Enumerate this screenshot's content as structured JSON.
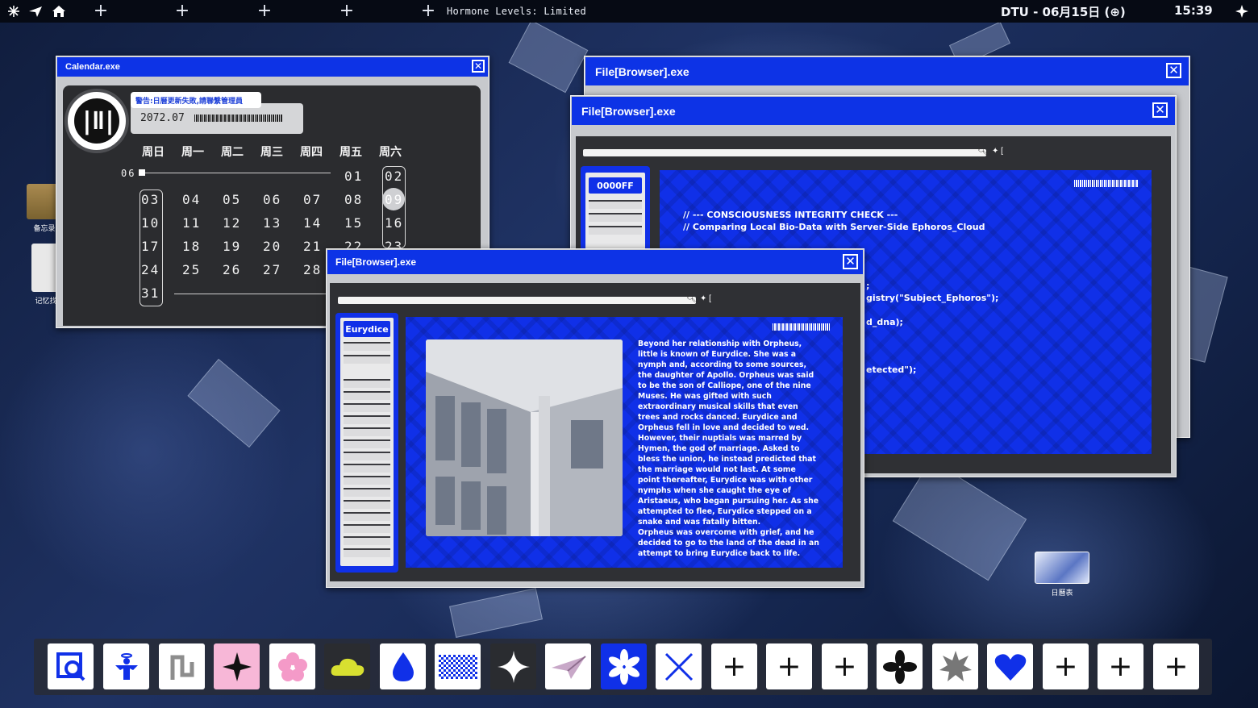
{
  "topbar": {
    "plus_glyph": "+",
    "status_text": "Hormone Levels: Limited",
    "date_text": "DTU - 06月15日 (⊕)",
    "time_text": "15:39",
    "icons": [
      "snowflake-icon",
      "paper-plane-icon",
      "home-icon",
      "sparkle-icon"
    ]
  },
  "calendar": {
    "title": "Calendar.exe",
    "close_glyph": "✕",
    "warning": "警告:日曆更新失敗,請聯繫管理員",
    "year_month": "2072.07",
    "weekdays": [
      "周日",
      "周一",
      "周二",
      "周三",
      "周四",
      "周五",
      "周六"
    ],
    "prev_month": "06",
    "days": {
      "d01": "01",
      "d02": "02",
      "d03": "03",
      "d04": "04",
      "d05": "05",
      "d06": "06",
      "d07": "07",
      "d08": "08",
      "d09": "09",
      "d10": "10",
      "d11": "11",
      "d12": "12",
      "d13": "13",
      "d14": "14",
      "d15": "15",
      "d16": "16",
      "d17": "17",
      "d18": "18",
      "d19": "19",
      "d20": "20",
      "d21": "21",
      "d22": "22",
      "d23": "23",
      "d24": "24",
      "d25": "25",
      "d26": "26",
      "d27": "27",
      "d28": "28",
      "d31": "31"
    },
    "selected_day": "09"
  },
  "browser_back": {
    "title": "File[Browser].exe",
    "close_glyph": "✕"
  },
  "browser_mid": {
    "title": "File[Browser].exe",
    "close_glyph": "✕",
    "search_symbols": "✦ [",
    "tag": "0000FF",
    "code": {
      "line1": "// --- CONSCIOUSNESS INTEGRITY CHECK ---",
      "line2": "// Comparing Local Bio-Data with Server-Side Ephoros_Cloud",
      "line3": ";",
      "line4": "gistry(\"Subject_Ephoros\");",
      "line5": "d_dna);",
      "line6": "etected\");"
    }
  },
  "browser_front": {
    "title": "File[Browser].exe",
    "close_glyph": "✕",
    "search_symbols": "✦ [",
    "tag": "Eurydice",
    "body_text": "Beyond her relationship with Orpheus, little is known of Eurydice. She was a nymph and, according to some sources, the daughter of Apollo. Orpheus was said to be the son of Calliope, one of the nine Muses. He was gifted with such extraordinary musical skills that even trees and rocks danced. Eurydice and Orpheus fell in love and decided to wed. However, their nuptials was marred by Hymen, the god of marriage. Asked to bless the union, he instead predicted that the marriage would not last. At some point thereafter, Eurydice was with other nymphs when she caught the eye of Aristaeus, who began pursuing her. As she attempted to flee, Eurydice stepped on a snake and was fatally bitten.\nOrpheus was overcome with grief, and he decided to go to the land of the dead in an attempt to bring Eurydice back to life."
  },
  "desktop_icons": {
    "folder_label": "备忘录",
    "notes_label": "记忆找",
    "calendar_label": "日曆表"
  },
  "dock": {
    "plus_glyph": "+",
    "icons": [
      "magnifier-icon",
      "angel-icon",
      "scribble-icon",
      "sparkle-icon",
      "flower-icon",
      "cloud-icon",
      "droplet-icon",
      "checker-icon",
      "star-icon",
      "paper-plane-icon",
      "asterisk-icon",
      "cross-icon",
      "plus-icon",
      "plus-icon",
      "plus-icon",
      "clover-icon",
      "burst-icon",
      "heart-icon",
      "plus-icon",
      "plus-icon",
      "plus-icon"
    ]
  }
}
